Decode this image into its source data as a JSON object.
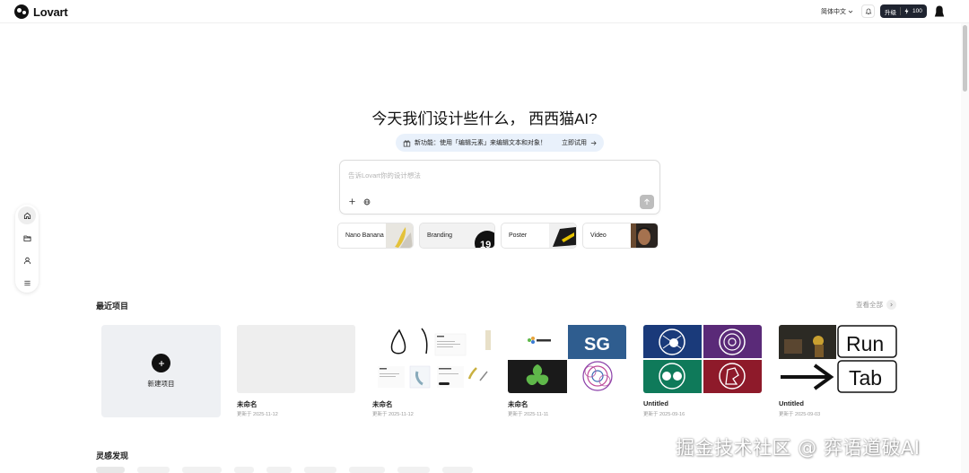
{
  "header": {
    "brand": "Lovart",
    "language": "简体中文",
    "upgrade_label": "升级",
    "credits": "100"
  },
  "nav": {
    "items": [
      {
        "icon": "home-icon",
        "active": true
      },
      {
        "icon": "folder-icon",
        "active": false
      },
      {
        "icon": "user-icon",
        "active": false
      },
      {
        "icon": "menu-icon",
        "active": false
      }
    ]
  },
  "hero": {
    "title": "今天我们设计些什么， 西西猫AI?",
    "promo_text": "新功能：使用「编辑元素」来编辑文本和对象！",
    "promo_cta": "立即试用",
    "input_placeholder": "告诉Lovart你的设计想法"
  },
  "chips": [
    {
      "label": "Nano Banana"
    },
    {
      "label": "Branding"
    },
    {
      "label": "Poster"
    },
    {
      "label": "Video"
    }
  ],
  "recent": {
    "title": "最近项目",
    "view_all": "查看全部",
    "new_label": "新建项目",
    "projects": [
      {
        "name": "未命名",
        "date": "更新于 2025-11-12"
      },
      {
        "name": "未命名",
        "date": "更新于 2025-11-12"
      },
      {
        "name": "未命名",
        "date": "更新于 2025-11-11"
      },
      {
        "name": "Untitled",
        "date": "更新于 2025-09-16"
      },
      {
        "name": "Untitled",
        "date": "更新于 2025-09-03"
      }
    ],
    "thumb_texts": {
      "sg": "SG",
      "run": "Run",
      "tab": "Tab"
    }
  },
  "inspiration": {
    "title": "灵感发现"
  },
  "watermark": "掘金技术社区 @ 弈语道破AI",
  "colors": {
    "upgrade_bg": "#1f2430",
    "promo_bg": "#e9f1fb",
    "card_bg": "#eef0f3",
    "sg_blue": "#2f5d8f",
    "green": "#5fb84a",
    "purple": "#5a2a78",
    "red": "#8e1a2a",
    "navy": "#1a3a7a"
  }
}
